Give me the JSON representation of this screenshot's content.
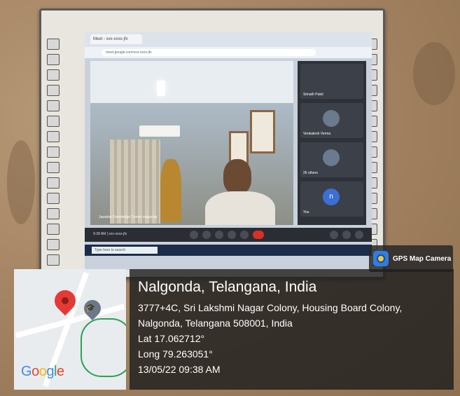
{
  "meeting_window": {
    "tab_title": "Meet - xxx-xxxx-jfx",
    "url": "meet.google.com/xxx-xxxx-jfx",
    "main_participant": "Jawahar Knowledge Center nalgonda",
    "panel_tiles": [
      {
        "name": "Srinath Patel"
      },
      {
        "name": "Venkatesh Verma"
      },
      {
        "name": "26 others"
      },
      {
        "name": "You",
        "initial": "n"
      }
    ],
    "time_and_code": "9:38 AM | xxx-xxxx-jfx",
    "taskbar_search": "Type here to search"
  },
  "gps_badge": {
    "label": "GPS Map Camera",
    "icon": "gps-camera-icon"
  },
  "location": {
    "title": "Nalgonda, Telangana, India",
    "address_line1": "3777+4C, Sri Lakshmi Nagar Colony, Housing Board Colony,",
    "address_line2": "Nalgonda, Telangana 508001, India",
    "lat": "Lat 17.062712°",
    "long": "Long 79.263051°",
    "datetime": "13/05/22 09:38 AM"
  },
  "map": {
    "brand": "Google",
    "pin_icons": [
      "map-pin-red-icon",
      "school-pin-icon"
    ]
  },
  "colors": {
    "overlay_bg": "#1e1e1e",
    "pin_red": "#e53935",
    "route_green": "#2f9e56",
    "gps_icon_blue": "#2f7de1"
  }
}
